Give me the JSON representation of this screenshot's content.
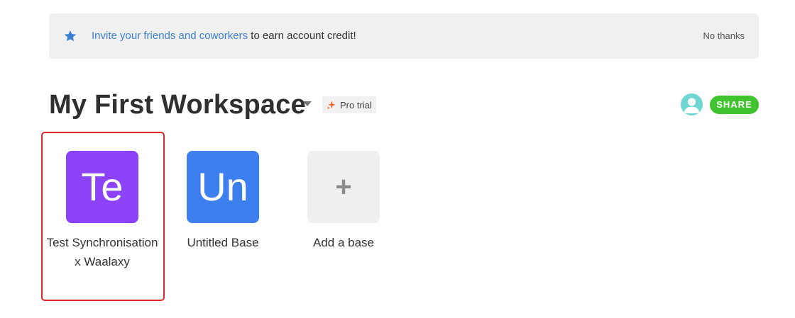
{
  "banner": {
    "link_text": "Invite your friends and coworkers",
    "message_text": " to earn account credit!",
    "dismiss_label": "No thanks",
    "icon": "star-icon",
    "accent_color": "#3b7fd1"
  },
  "workspace": {
    "title": "My First Workspace",
    "badge_label": "Pro trial",
    "badge_icon": "sparkle-icon",
    "share_label": "SHARE",
    "share_color": "#3fc42f"
  },
  "bases": [
    {
      "initials": "Te",
      "name": "Test Synchronisation x Waalaxy",
      "color": "#8c43f8",
      "selected": true
    },
    {
      "initials": "Un",
      "name": "Untitled Base",
      "color": "#3e7ff0",
      "selected": false
    }
  ],
  "add_base": {
    "icon_glyph": "+",
    "label": "Add a base"
  }
}
